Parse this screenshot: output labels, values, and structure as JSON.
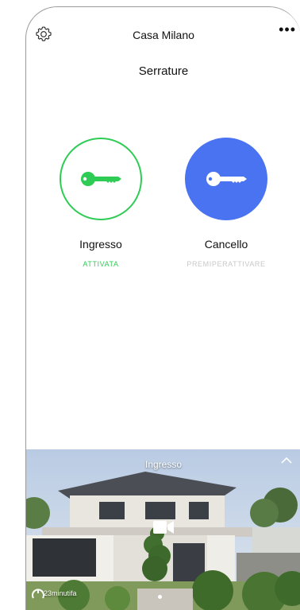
{
  "header": {
    "title": "Casa Milano",
    "settings_icon": "gear-icon",
    "more_icon": "more-icon",
    "more_label": "•••"
  },
  "section": {
    "title": "Serrature"
  },
  "locks": [
    {
      "name": "Ingresso",
      "status": "ATTIVATA",
      "icon": "key-icon",
      "color": "#2ecc55"
    },
    {
      "name": "Cancello",
      "status": "PREMIPERATTIVARE",
      "icon": "key-icon",
      "color": "#4a73f2"
    }
  ],
  "camera": {
    "title": "Ingresso",
    "time": "23minutifa",
    "chevron_icon": "chevron-up-icon",
    "video_icon": "video-camera-icon"
  }
}
